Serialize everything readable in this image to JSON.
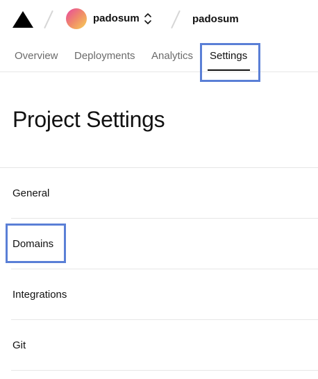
{
  "header": {
    "scope_name": "padosum",
    "project_name": "padosum",
    "logo_icon": "triangle-logo-icon",
    "selector_icon": "chevron-up-down-icon"
  },
  "tabs": [
    {
      "label": "Overview",
      "active": false
    },
    {
      "label": "Deployments",
      "active": false
    },
    {
      "label": "Analytics",
      "active": false
    },
    {
      "label": "Settings",
      "active": true
    }
  ],
  "main": {
    "title": "Project Settings"
  },
  "settings_nav": {
    "items": [
      {
        "label": "General"
      },
      {
        "label": "Domains"
      },
      {
        "label": "Integrations"
      },
      {
        "label": "Git"
      }
    ]
  },
  "colors": {
    "highlight": "#5a7fd6",
    "border": "#e6e6e6",
    "muted_text": "#6b6b6b"
  }
}
